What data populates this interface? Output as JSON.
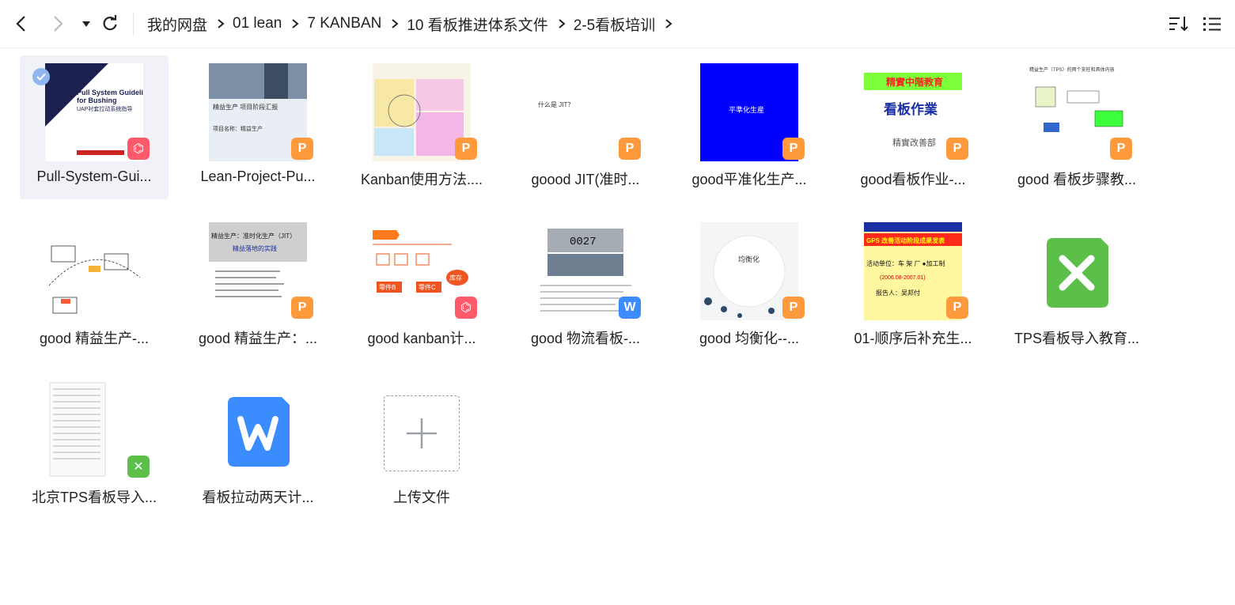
{
  "breadcrumb": [
    "我的网盘",
    "01 lean",
    "7 KANBAN",
    "10 看板推进体系文件",
    "2-5看板培训"
  ],
  "files": [
    {
      "name": "Pull-System-Gui...",
      "type": "pdf",
      "selected": true,
      "thumb": "Pull System Guideline for Bushing UAP衬套拉动系统指导"
    },
    {
      "name": "Lean-Project-Pu...",
      "type": "ppt",
      "thumb": "精益生产 项目阶段汇报"
    },
    {
      "name": "Kanban使用方法....",
      "type": "ppt",
      "thumb": ""
    },
    {
      "name": "goood JIT(准时...",
      "type": "ppt",
      "thumb": "什么是 JIT？"
    },
    {
      "name": "good平准化生产...",
      "type": "ppt",
      "thumb": "平准化生産"
    },
    {
      "name": "good看板作业-...",
      "type": "ppt",
      "thumb": "精實中階教育 看板作業 精實改善部"
    },
    {
      "name": "good 看板步骤教...",
      "type": "ppt",
      "thumb": "精益生产（TPS）的两个支柱和具体内容"
    },
    {
      "name": "good 精益生产-...",
      "type": "ppt",
      "thumb": ""
    },
    {
      "name": "good 精益生产：...",
      "type": "ppt",
      "thumb": "精益生产：准时化生产（JIT） 精益落地的实践"
    },
    {
      "name": "good kanban计...",
      "type": "pdf",
      "thumb": "零件B 零件C 库存"
    },
    {
      "name": "good  物流看板-...",
      "type": "doc",
      "thumb": "0027"
    },
    {
      "name": "good  均衡化--...",
      "type": "ppt",
      "thumb": "均衡化"
    },
    {
      "name": "01-顺序后补充生...",
      "type": "ppt",
      "thumb": "GPS 改善活动阶段成果发表 活动单位：车 架 厂 ●加工制 (2006.08-2007.01) 报告人：吴邦付"
    },
    {
      "name": "TPS看板导入教育...",
      "type": "xls-app",
      "thumb": ""
    },
    {
      "name": "北京TPS看板导入...",
      "type": "xls",
      "thumb": ""
    },
    {
      "name": "看板拉动两天计...",
      "type": "doc-app",
      "thumb": ""
    },
    {
      "name": "上传文件",
      "type": "upload",
      "thumb": ""
    }
  ],
  "icons": {
    "back": "chevron-left-icon",
    "forward": "chevron-right-icon",
    "dropdown": "caret-down-icon",
    "refresh": "refresh-icon",
    "sort": "sort-icon",
    "view": "list-view-icon"
  },
  "colors": {
    "ppt": "#ff9a3c",
    "pdf": "#ff5a6a",
    "doc": "#3b8cff",
    "xls": "#5bbf4a",
    "selected_bg": "#f0f2f7"
  }
}
